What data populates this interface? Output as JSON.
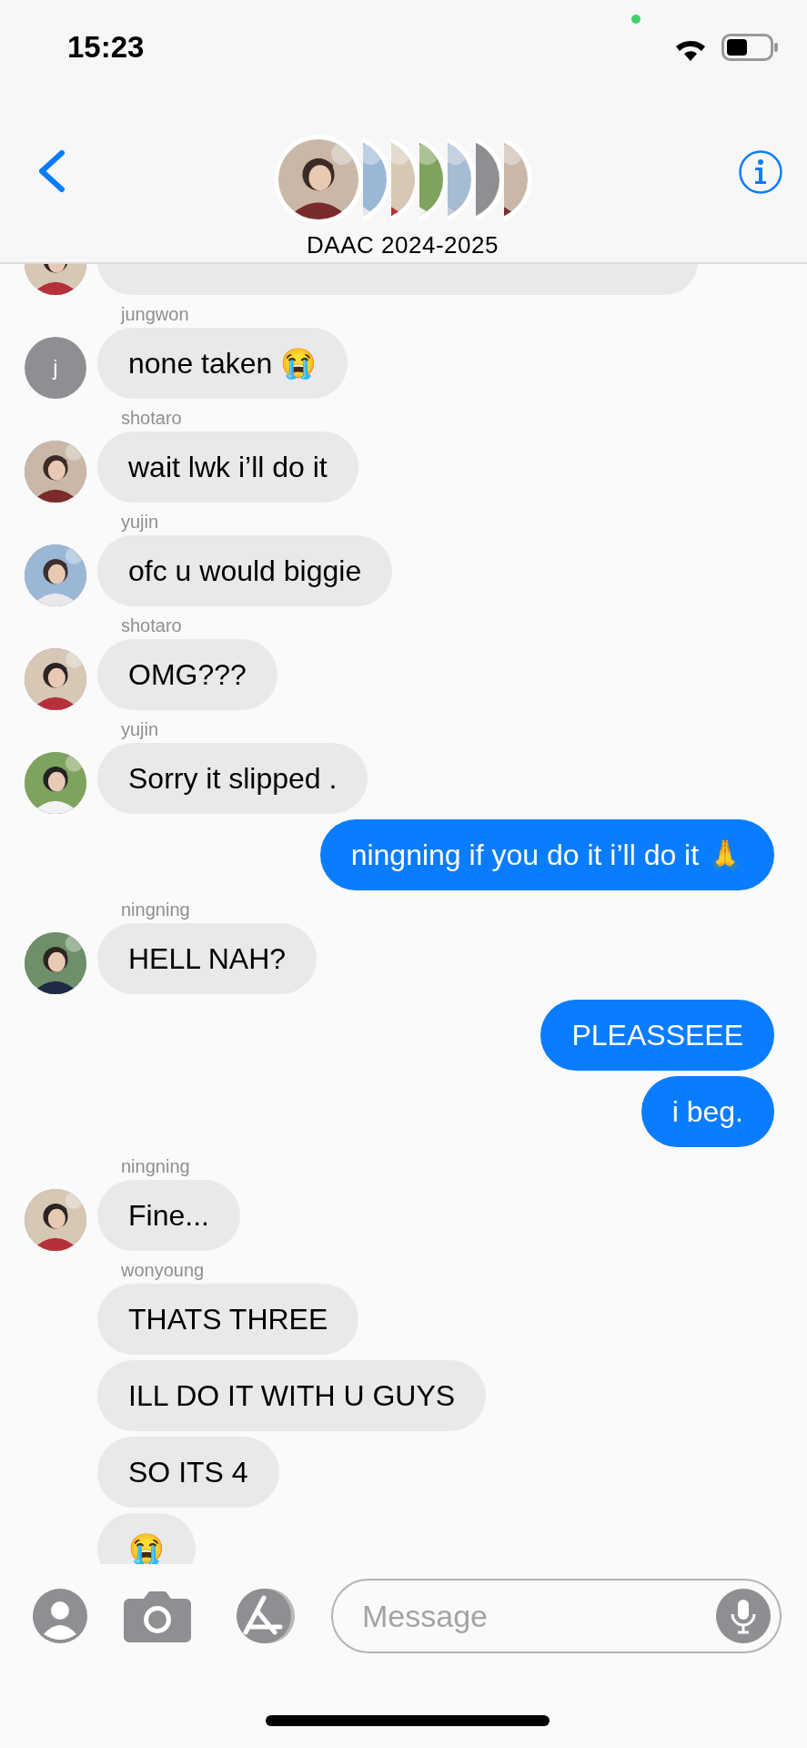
{
  "status_bar": {
    "time": "15:23",
    "camera_in_use": true
  },
  "header": {
    "title": "DAAC 2024-2025",
    "group_avatars": [
      {
        "kind": "picture"
      },
      {
        "kind": "picture"
      },
      {
        "kind": "picture"
      },
      {
        "kind": "picture"
      },
      {
        "kind": "picture"
      },
      {
        "kind": "blank"
      },
      {
        "kind": "picture"
      }
    ]
  },
  "top_clipped_message": {
    "avatar": {
      "kind": "picture"
    }
  },
  "messages": [
    {
      "kind": "received",
      "sender": "jungwon",
      "text": "none taken 😭",
      "avatar": {
        "kind": "initial",
        "text": "j"
      }
    },
    {
      "kind": "received",
      "sender": "shotaro",
      "text": "wait lwk i’ll do it",
      "avatar": {
        "kind": "picture"
      }
    },
    {
      "kind": "received",
      "sender": "yujin",
      "text": "ofc u would biggie",
      "avatar": {
        "kind": "picture"
      }
    },
    {
      "kind": "received",
      "sender": "shotaro",
      "text": "OMG???",
      "avatar": {
        "kind": "picture"
      }
    },
    {
      "kind": "received",
      "sender": "yujin",
      "text": "Sorry it slipped .",
      "avatar": {
        "kind": "picture"
      }
    },
    {
      "kind": "sent",
      "text": "ningning if you do it i’ll do it 🙏"
    },
    {
      "kind": "received",
      "sender": "ningning",
      "text": "HELL NAH?",
      "avatar": {
        "kind": "picture"
      }
    },
    {
      "kind": "sent",
      "text": "PLEASSEEE"
    },
    {
      "kind": "sent",
      "text": "i beg."
    },
    {
      "kind": "received",
      "sender": "ningning",
      "text": "Fine...",
      "avatar": {
        "kind": "picture"
      }
    },
    {
      "kind": "received",
      "sender": "wonyoung",
      "text": "THATS THREE"
    },
    {
      "kind": "received",
      "text": "ILL DO IT WITH U GUYS"
    },
    {
      "kind": "received",
      "text": "SO ITS 4"
    },
    {
      "kind": "received",
      "text": "😭"
    }
  ],
  "composer": {
    "placeholder": "Message"
  }
}
